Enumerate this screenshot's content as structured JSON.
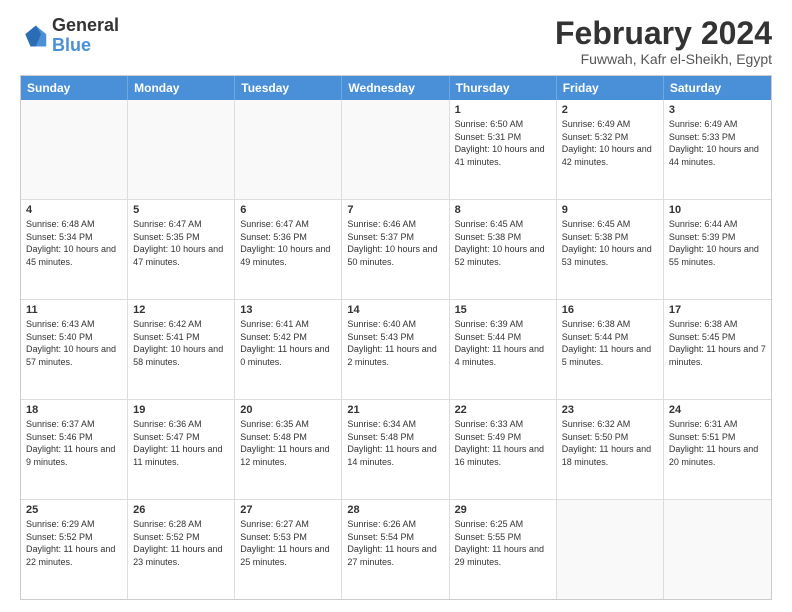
{
  "logo": {
    "general": "General",
    "blue": "Blue"
  },
  "header": {
    "month_year": "February 2024",
    "location": "Fuwwah, Kafr el-Sheikh, Egypt"
  },
  "days_of_week": [
    "Sunday",
    "Monday",
    "Tuesday",
    "Wednesday",
    "Thursday",
    "Friday",
    "Saturday"
  ],
  "weeks": [
    [
      {
        "day": "",
        "text": ""
      },
      {
        "day": "",
        "text": ""
      },
      {
        "day": "",
        "text": ""
      },
      {
        "day": "",
        "text": ""
      },
      {
        "day": "1",
        "text": "Sunrise: 6:50 AM\nSunset: 5:31 PM\nDaylight: 10 hours and 41 minutes."
      },
      {
        "day": "2",
        "text": "Sunrise: 6:49 AM\nSunset: 5:32 PM\nDaylight: 10 hours and 42 minutes."
      },
      {
        "day": "3",
        "text": "Sunrise: 6:49 AM\nSunset: 5:33 PM\nDaylight: 10 hours and 44 minutes."
      }
    ],
    [
      {
        "day": "4",
        "text": "Sunrise: 6:48 AM\nSunset: 5:34 PM\nDaylight: 10 hours and 45 minutes."
      },
      {
        "day": "5",
        "text": "Sunrise: 6:47 AM\nSunset: 5:35 PM\nDaylight: 10 hours and 47 minutes."
      },
      {
        "day": "6",
        "text": "Sunrise: 6:47 AM\nSunset: 5:36 PM\nDaylight: 10 hours and 49 minutes."
      },
      {
        "day": "7",
        "text": "Sunrise: 6:46 AM\nSunset: 5:37 PM\nDaylight: 10 hours and 50 minutes."
      },
      {
        "day": "8",
        "text": "Sunrise: 6:45 AM\nSunset: 5:38 PM\nDaylight: 10 hours and 52 minutes."
      },
      {
        "day": "9",
        "text": "Sunrise: 6:45 AM\nSunset: 5:38 PM\nDaylight: 10 hours and 53 minutes."
      },
      {
        "day": "10",
        "text": "Sunrise: 6:44 AM\nSunset: 5:39 PM\nDaylight: 10 hours and 55 minutes."
      }
    ],
    [
      {
        "day": "11",
        "text": "Sunrise: 6:43 AM\nSunset: 5:40 PM\nDaylight: 10 hours and 57 minutes."
      },
      {
        "day": "12",
        "text": "Sunrise: 6:42 AM\nSunset: 5:41 PM\nDaylight: 10 hours and 58 minutes."
      },
      {
        "day": "13",
        "text": "Sunrise: 6:41 AM\nSunset: 5:42 PM\nDaylight: 11 hours and 0 minutes."
      },
      {
        "day": "14",
        "text": "Sunrise: 6:40 AM\nSunset: 5:43 PM\nDaylight: 11 hours and 2 minutes."
      },
      {
        "day": "15",
        "text": "Sunrise: 6:39 AM\nSunset: 5:44 PM\nDaylight: 11 hours and 4 minutes."
      },
      {
        "day": "16",
        "text": "Sunrise: 6:38 AM\nSunset: 5:44 PM\nDaylight: 11 hours and 5 minutes."
      },
      {
        "day": "17",
        "text": "Sunrise: 6:38 AM\nSunset: 5:45 PM\nDaylight: 11 hours and 7 minutes."
      }
    ],
    [
      {
        "day": "18",
        "text": "Sunrise: 6:37 AM\nSunset: 5:46 PM\nDaylight: 11 hours and 9 minutes."
      },
      {
        "day": "19",
        "text": "Sunrise: 6:36 AM\nSunset: 5:47 PM\nDaylight: 11 hours and 11 minutes."
      },
      {
        "day": "20",
        "text": "Sunrise: 6:35 AM\nSunset: 5:48 PM\nDaylight: 11 hours and 12 minutes."
      },
      {
        "day": "21",
        "text": "Sunrise: 6:34 AM\nSunset: 5:48 PM\nDaylight: 11 hours and 14 minutes."
      },
      {
        "day": "22",
        "text": "Sunrise: 6:33 AM\nSunset: 5:49 PM\nDaylight: 11 hours and 16 minutes."
      },
      {
        "day": "23",
        "text": "Sunrise: 6:32 AM\nSunset: 5:50 PM\nDaylight: 11 hours and 18 minutes."
      },
      {
        "day": "24",
        "text": "Sunrise: 6:31 AM\nSunset: 5:51 PM\nDaylight: 11 hours and 20 minutes."
      }
    ],
    [
      {
        "day": "25",
        "text": "Sunrise: 6:29 AM\nSunset: 5:52 PM\nDaylight: 11 hours and 22 minutes."
      },
      {
        "day": "26",
        "text": "Sunrise: 6:28 AM\nSunset: 5:52 PM\nDaylight: 11 hours and 23 minutes."
      },
      {
        "day": "27",
        "text": "Sunrise: 6:27 AM\nSunset: 5:53 PM\nDaylight: 11 hours and 25 minutes."
      },
      {
        "day": "28",
        "text": "Sunrise: 6:26 AM\nSunset: 5:54 PM\nDaylight: 11 hours and 27 minutes."
      },
      {
        "day": "29",
        "text": "Sunrise: 6:25 AM\nSunset: 5:55 PM\nDaylight: 11 hours and 29 minutes."
      },
      {
        "day": "",
        "text": ""
      },
      {
        "day": "",
        "text": ""
      }
    ]
  ]
}
